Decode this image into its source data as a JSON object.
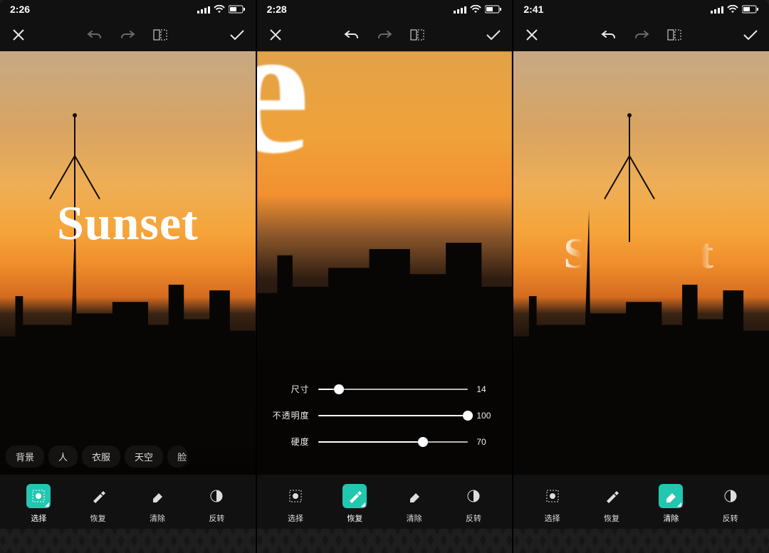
{
  "screens": [
    {
      "status_time": "2:26",
      "canvas_text": "Sunset",
      "chips": [
        "背景",
        "人",
        "衣服",
        "天空",
        "脸"
      ],
      "tools": [
        {
          "label": "选择",
          "icon": "select",
          "active": true
        },
        {
          "label": "恢复",
          "icon": "brush",
          "active": false
        },
        {
          "label": "清除",
          "icon": "eraser",
          "active": false
        },
        {
          "label": "反转",
          "icon": "invert",
          "active": false
        }
      ]
    },
    {
      "status_time": "2:28",
      "canvas_text": "se",
      "sliders": [
        {
          "label": "尺寸",
          "value": 14,
          "max": 100
        },
        {
          "label": "不透明度",
          "value": 100,
          "max": 100
        },
        {
          "label": "硬度",
          "value": 70,
          "max": 100
        }
      ],
      "tools": [
        {
          "label": "选择",
          "icon": "select",
          "active": false
        },
        {
          "label": "恢复",
          "icon": "brush",
          "active": true
        },
        {
          "label": "清除",
          "icon": "eraser",
          "active": false
        },
        {
          "label": "反转",
          "icon": "invert",
          "active": false
        }
      ]
    },
    {
      "status_time": "2:41",
      "canvas_text": "Sunset",
      "tools": [
        {
          "label": "选择",
          "icon": "select",
          "active": false
        },
        {
          "label": "恢复",
          "icon": "brush",
          "active": false
        },
        {
          "label": "清除",
          "icon": "eraser",
          "active": true
        },
        {
          "label": "反转",
          "icon": "invert",
          "active": false
        }
      ]
    }
  ]
}
